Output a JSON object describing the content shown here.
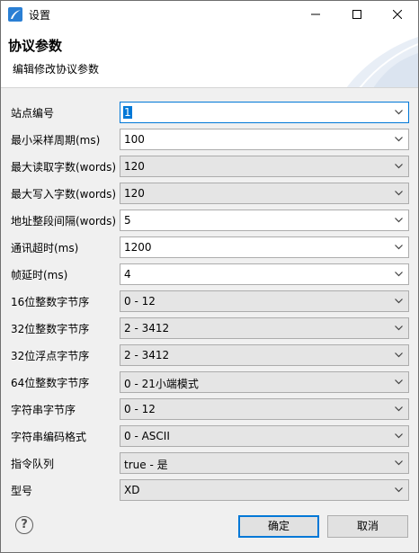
{
  "window": {
    "title": "设置",
    "icon": "app-feather-icon",
    "controls": [
      "minimize-icon",
      "maximize-icon",
      "close-icon"
    ]
  },
  "header": {
    "title": "协议参数",
    "description": "编辑修改协议参数"
  },
  "fields": [
    {
      "label": "站点编号",
      "value": "1",
      "editable": true
    },
    {
      "label": "最小采样周期(ms)",
      "value": "100",
      "editable": true
    },
    {
      "label": "最大读取字数(words)",
      "value": "120",
      "editable": false
    },
    {
      "label": "最大写入字数(words)",
      "value": "120",
      "editable": false
    },
    {
      "label": "地址整段间隔(words)",
      "value": "5",
      "editable": true
    },
    {
      "label": "通讯超时(ms)",
      "value": "1200",
      "editable": true
    },
    {
      "label": "帧延时(ms)",
      "value": "4",
      "editable": true
    },
    {
      "label": "16位整数字节序",
      "value": "0 - 12",
      "editable": false
    },
    {
      "label": "32位整数字节序",
      "value": "2 - 3412",
      "editable": false
    },
    {
      "label": "32位浮点字节序",
      "value": "2 - 3412",
      "editable": false
    },
    {
      "label": "64位整数字节序",
      "value": "0 - 21小端模式",
      "editable": false
    },
    {
      "label": "字符串字节序",
      "value": "0 - 12",
      "editable": false
    },
    {
      "label": "字符串编码格式",
      "value": "0 - ASCII",
      "editable": false
    },
    {
      "label": "指令队列",
      "value": "true - 是",
      "editable": false
    },
    {
      "label": "型号",
      "value": "XD",
      "editable": false
    }
  ],
  "footer": {
    "help_icon": "help-icon",
    "help_glyph": "?",
    "ok_label": "确定",
    "cancel_label": "取消"
  },
  "colors": {
    "accent": "#0078d7",
    "readonly_bg": "#e5e5e5",
    "dialog_bg": "#f0f0f0"
  }
}
